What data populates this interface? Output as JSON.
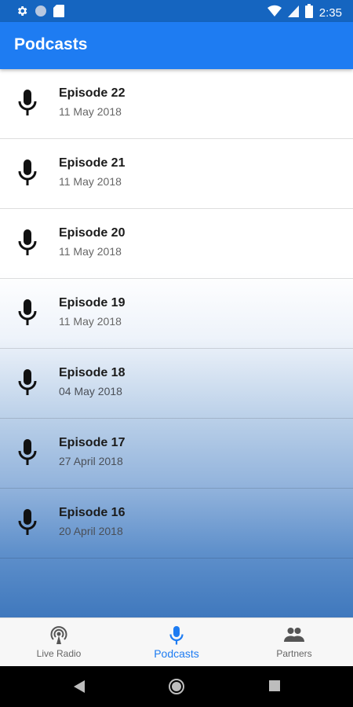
{
  "status": {
    "time": "2:35",
    "icons": [
      "gear-icon",
      "circle-icon",
      "sd-card-icon",
      "wifi-icon",
      "cell-signal-icon",
      "battery-icon"
    ]
  },
  "app_bar": {
    "title": "Podcasts"
  },
  "episodes": [
    {
      "title": "Episode 22",
      "date": "11 May 2018",
      "icon": "microphone-icon"
    },
    {
      "title": "Episode 21",
      "date": "11 May 2018",
      "icon": "microphone-icon"
    },
    {
      "title": "Episode 20",
      "date": "11 May 2018",
      "icon": "microphone-icon"
    },
    {
      "title": "Episode 19",
      "date": "11 May 2018",
      "icon": "microphone-icon"
    },
    {
      "title": "Episode 18",
      "date": "04 May 2018",
      "icon": "microphone-icon"
    },
    {
      "title": "Episode 17",
      "date": "27 April 2018",
      "icon": "microphone-icon"
    },
    {
      "title": "Episode 16",
      "date": "20 April 2018",
      "icon": "microphone-icon"
    }
  ],
  "bottom_nav": {
    "items": [
      {
        "label": "Live Radio",
        "icon": "radio-tower-icon",
        "active": false
      },
      {
        "label": "Podcasts",
        "icon": "microphone-icon",
        "active": true
      },
      {
        "label": "Partners",
        "icon": "people-icon",
        "active": false
      }
    ]
  },
  "colors": {
    "primary": "#1e7cf2",
    "status_bar": "#1565c0",
    "active_nav": "#1e7cf2",
    "gradient_bottom": "#3f78bd"
  }
}
